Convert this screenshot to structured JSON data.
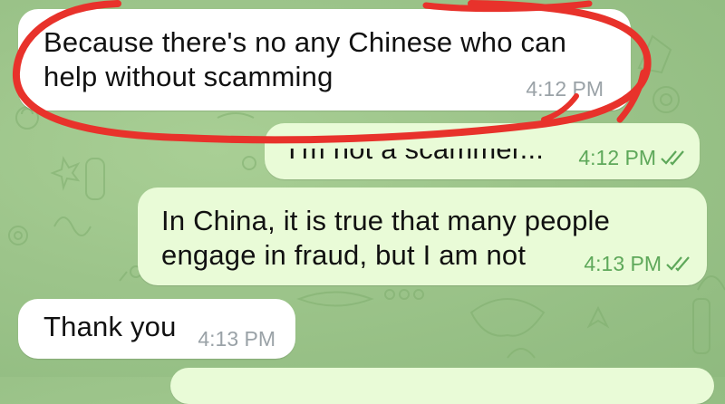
{
  "messages": [
    {
      "direction": "incoming",
      "lines": [
        "Because there's no any Chinese who can",
        "help without scamming"
      ],
      "time": "4:12 PM"
    },
    {
      "direction": "outgoing",
      "lines": [
        "I'm not a scammer..."
      ],
      "time": "4:12 PM",
      "status": "read-double-check-icon"
    },
    {
      "direction": "outgoing",
      "lines": [
        "In China, it is true that many people",
        "engage in fraud, but I am not"
      ],
      "time": "4:13 PM",
      "status": "read-double-check-icon"
    },
    {
      "direction": "incoming",
      "lines": [
        "Thank you"
      ],
      "time": "4:13 PM"
    }
  ],
  "colors": {
    "wallpaper": "#9cc48a",
    "incoming_bubble": "#ffffff",
    "outgoing_bubble": "#e9fbd7",
    "outgoing_meta": "#5ea85a",
    "incoming_meta": "#9aa2a7",
    "annotation_marker": "#e8322b"
  }
}
